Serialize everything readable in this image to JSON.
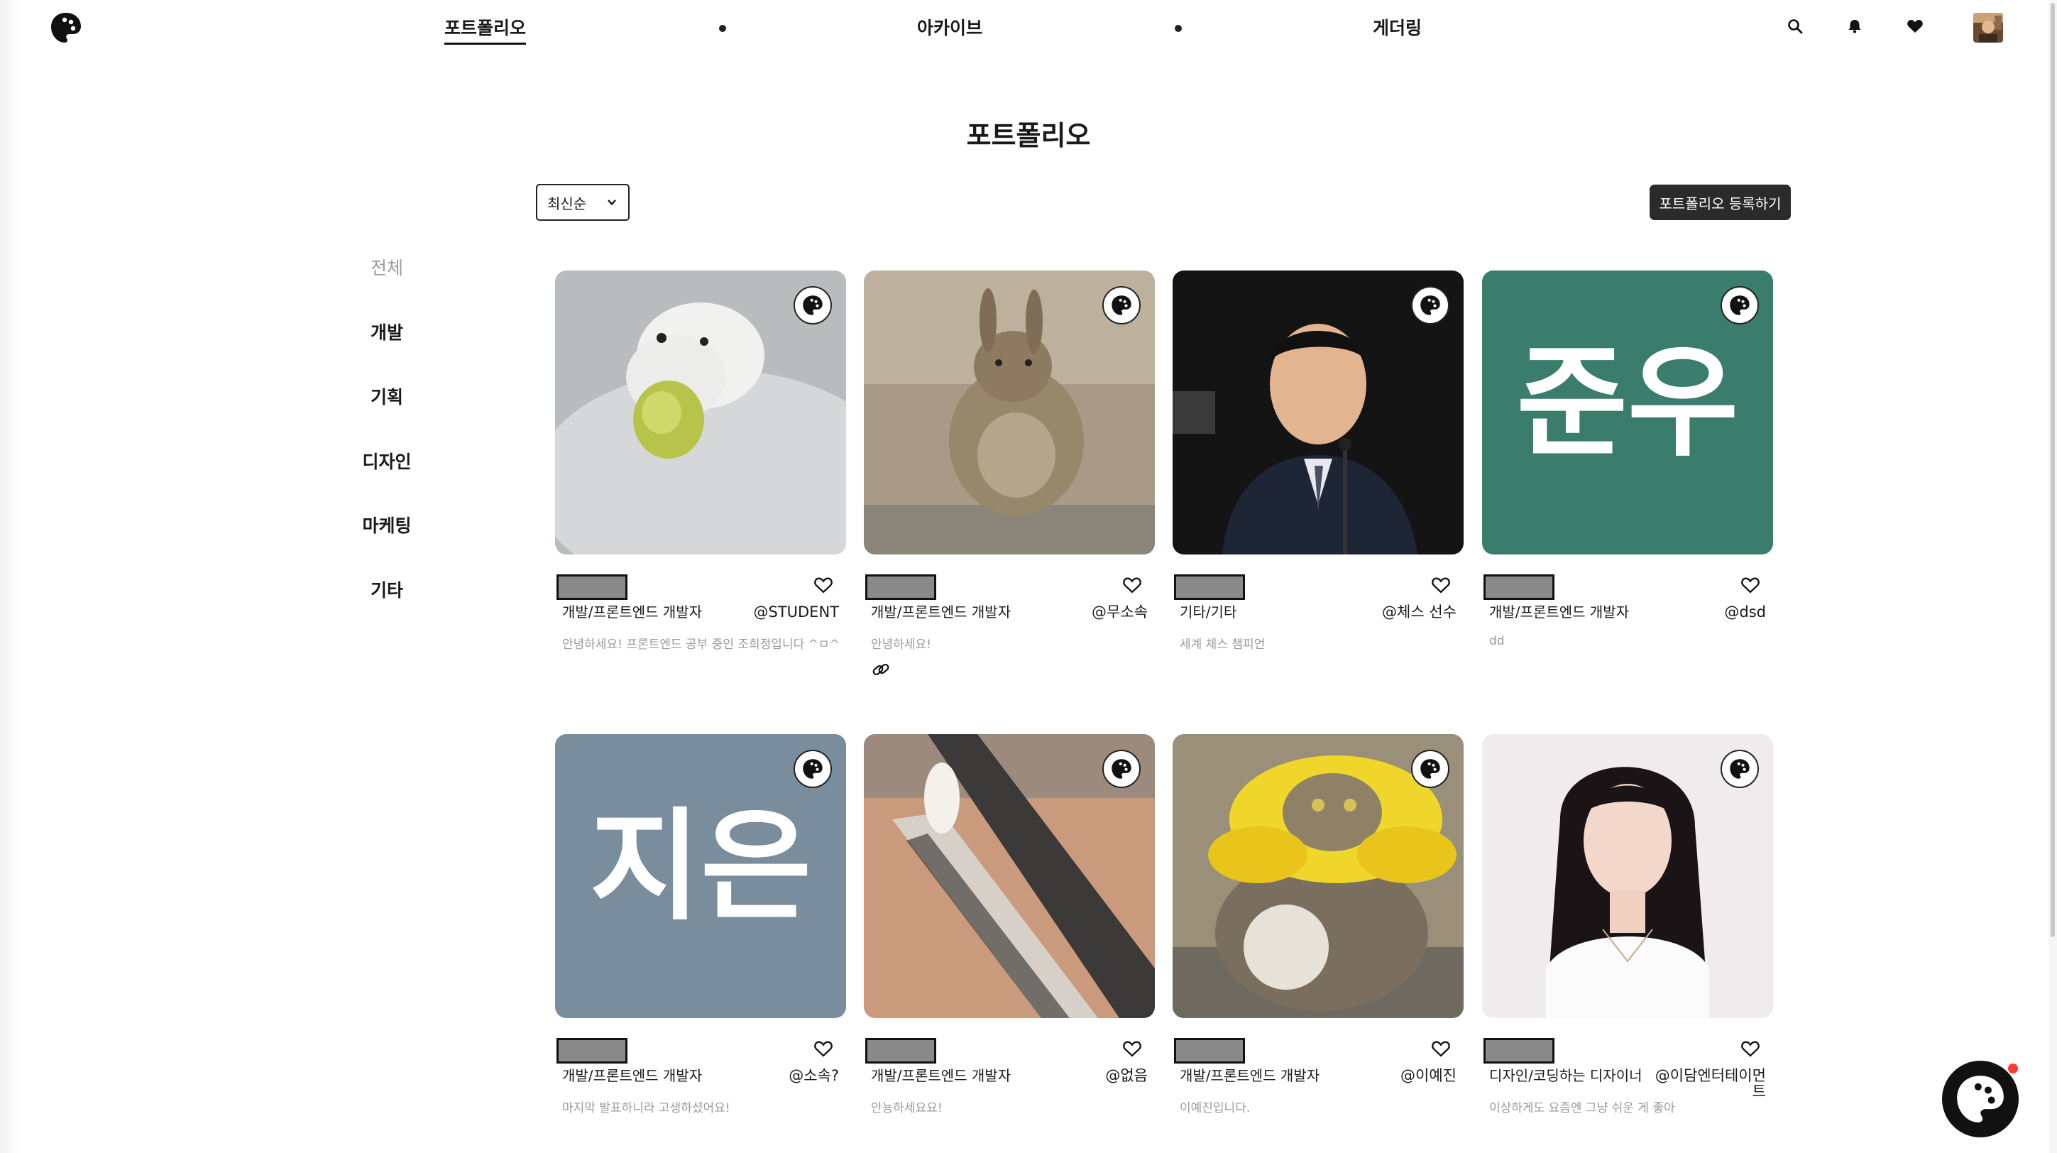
{
  "nav": {
    "items": [
      "포트폴리오",
      "아카이브",
      "게더링"
    ],
    "active_index": 0
  },
  "page": {
    "title": "포트폴리오"
  },
  "toolbar": {
    "sort_selected": "최신순",
    "register_label": "포트폴리오 등록하기"
  },
  "categories": [
    "전체",
    "개발",
    "기획",
    "디자인",
    "마케팅",
    "기타"
  ],
  "cards": [
    {
      "image": "hamster-photo",
      "category": "개발/프론트엔드 개발자",
      "user": "@STUDENT",
      "description": "안녕하세요! 프론트엔드 공부 중인 조희정입니다 ^ㅁ^",
      "has_link": false
    },
    {
      "image": "viscacha-photo",
      "category": "개발/프론트엔드 개발자",
      "user": "@무소속",
      "description": "안녕하세요!",
      "has_link": true
    },
    {
      "image": "man-in-suit-photo",
      "category": "기타/기타",
      "user": "@체스 선수",
      "description": "세계 체스 챔피언",
      "has_link": false
    },
    {
      "image": "name-tile",
      "image_text": "준우",
      "image_color": "#3a7d6c",
      "category": "개발/프론트엔드 개발자",
      "user": "@dsd",
      "description": "dd",
      "has_link": false
    },
    {
      "image": "name-tile",
      "image_text": "지은",
      "image_color": "#7a8d9c",
      "category": "개발/프론트엔드 개발자",
      "user": "@소속?",
      "description": "마지막 발표하니라 고생하셨어요!",
      "has_link": false
    },
    {
      "image": "pens-photo",
      "category": "개발/프론트엔드 개발자",
      "user": "@없음",
      "description": "안뇽하세요요!",
      "has_link": false
    },
    {
      "image": "cat-photo",
      "category": "개발/프론트엔드 개발자",
      "user": "@이예진",
      "description": "이예진입니다.",
      "has_link": false
    },
    {
      "image": "woman-portrait-photo",
      "category": "디자인/코딩하는 디자이너",
      "user": "@이담엔터테이먼트",
      "description": "이상하게도 요즘엔 그냥 쉬운 게 좋아",
      "has_link": false
    }
  ],
  "icons": {
    "logo": "palette-icon",
    "header": [
      "search-icon",
      "bell-icon",
      "heart-filled-icon"
    ],
    "card_badge": "palette-icon",
    "card_like": "heart-outline-icon",
    "card_link": "link-icon",
    "fab": "palette-icon"
  },
  "colors": {
    "primary": "#111111",
    "muted": "#9a9a9a",
    "notification": "#ff3b30"
  }
}
